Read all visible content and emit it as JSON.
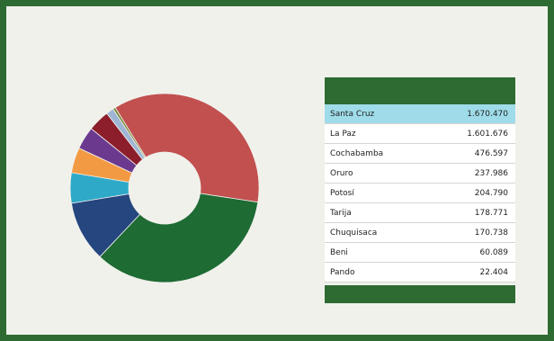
{
  "header": {
    "title": "",
    "subtitle": ""
  },
  "colors": {
    "frame": "#2e6b33",
    "table_header": "#2e6b33",
    "highlight_row": "#9fdcea"
  },
  "chart_data": {
    "type": "pie",
    "donut": true,
    "title": "",
    "slices": [
      {
        "name": "Santa Cruz",
        "value": 1670,
        "color": "#c1504f"
      },
      {
        "name": "La Paz",
        "value": 1600,
        "color": "#1e6b34"
      },
      {
        "name": "Cochabamba",
        "value": 480,
        "color": "#25467f"
      },
      {
        "name": "Oruro",
        "value": 240,
        "color": "#2fa9c8"
      },
      {
        "name": "Potosí",
        "value": 200,
        "color": "#f29a43"
      },
      {
        "name": "Tarija",
        "value": 180,
        "color": "#6b3a8f"
      },
      {
        "name": "Chuquisaca",
        "value": 170,
        "color": "#8b1e2a"
      },
      {
        "name": "Beni",
        "value": 60,
        "color": "#9fb5d4"
      },
      {
        "name": "Pando",
        "value": 20,
        "color": "#7a8a3a"
      }
    ]
  },
  "table": {
    "header_col1": "",
    "header_col2": "",
    "rows": [
      {
        "name": "Santa Cruz",
        "value": "1.670.470",
        "highlight": true
      },
      {
        "name": "La Paz",
        "value": "1.601.676"
      },
      {
        "name": "Cochabamba",
        "value": "476.597"
      },
      {
        "name": "Oruro",
        "value": "237.986"
      },
      {
        "name": "Potosí",
        "value": "204.790"
      },
      {
        "name": "Tarija",
        "value": "178.771"
      },
      {
        "name": "Chuquisaca",
        "value": "170.738"
      },
      {
        "name": "Beni",
        "value": "60.089"
      },
      {
        "name": "Pando",
        "value": "22.404"
      }
    ],
    "total_label": "",
    "total_value": ""
  },
  "footer": {
    "line1": "",
    "line2": ""
  }
}
